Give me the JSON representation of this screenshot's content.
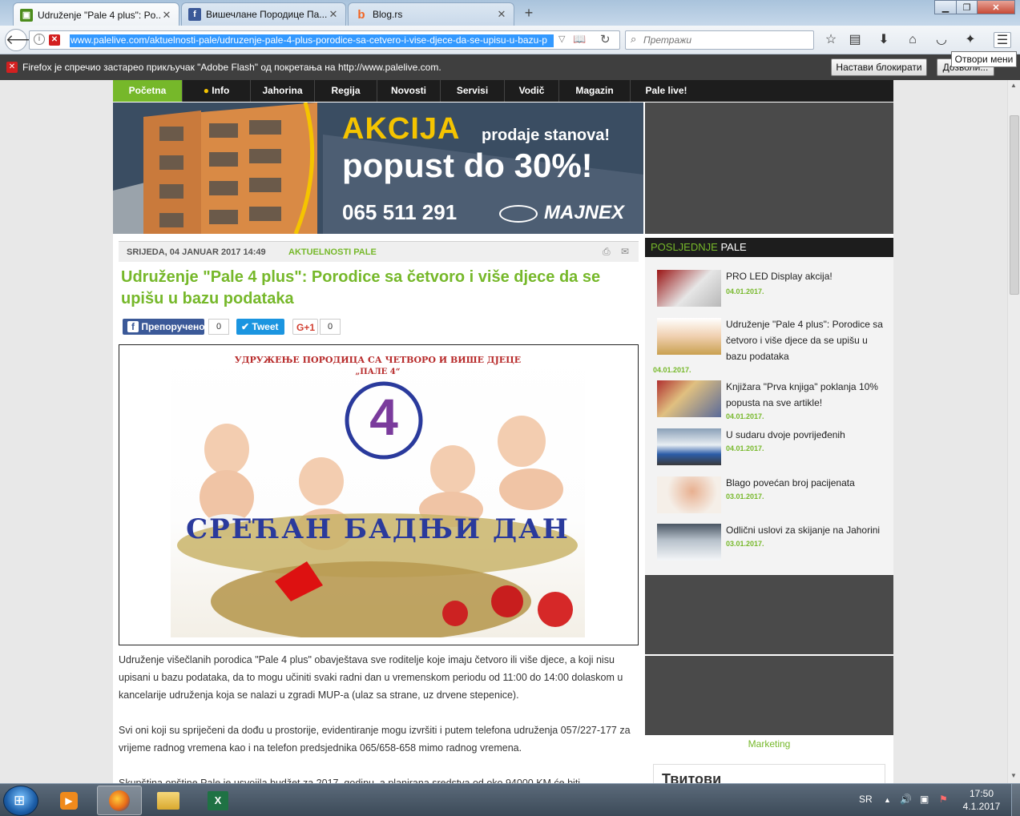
{
  "tabs": [
    {
      "label": "Udruženje \"Pale 4 plus\": Po...",
      "active": true,
      "favicon": "palelive-icon"
    },
    {
      "label": "Вишечлане Породице Па...",
      "active": false,
      "favicon": "facebook-icon"
    },
    {
      "label": "Blog.rs",
      "active": false,
      "favicon": "blog-icon"
    }
  ],
  "toolbar": {
    "url": "www.palelive.com/aktuelnosti-pale/udruzenje-pale-4-plus-porodice-sa-cetvero-i-vise-djece-da-se-upisu-u-bazu-p",
    "search_placeholder": "Претражи",
    "menu_tooltip": "Отвори мени"
  },
  "notification": {
    "message": "Firefox je спречио застарео прикључак \"Adobe Flash\" од покретања на http://www.palelive.com.",
    "continue_blocking": "Настави блокирати",
    "allow": "Дозволи..."
  },
  "menu": [
    "Početna",
    "Info",
    "Jahorina",
    "Regija",
    "Novosti",
    "Servisi",
    "Vodič",
    "Magazin",
    "Pale live!"
  ],
  "banner": {
    "headline": "AKCIJA",
    "sub": "prodaje stanova!",
    "discount": "popust do 30%!",
    "phone": "065 511 291",
    "brand": "MAJNEX"
  },
  "article": {
    "date": "SRIJEDA, 04 JANUAR 2017 14:49",
    "category": "AKTUELNOSTI PALE",
    "title": "Udruženje \"Pale 4 plus\": Porodice sa četvoro i više djece da se upišu u bazu podataka",
    "social": {
      "fb_label": "Препоручено",
      "fb_count": "0",
      "tw_label": "Tweet",
      "gp_label": "G+1",
      "gp_count": "0"
    },
    "image": {
      "top_text": "УДРУЖЕЊЕ ПОРОДИЦА СА ЧЕТВОРО И ВИШЕ ДЈЕЦЕ",
      "top_text2": "„ПАЛЕ 4“",
      "logo_digit": "4",
      "greeting": "СРЕЋАН БАДЊИ ДАН"
    },
    "paragraphs": [
      "Udruženje višečlanih porodica \"Pale 4 plus\" obavještava sve roditelje koje imaju četvoro ili više djece, a koji nisu upisani u bazu podataka, da to mogu učiniti svaki radni dan u vremenskom periodu od 11:00 do 14:00 dolaskom u kancelarije udruženja koja se nalazi u zgradi MUP-a (ulaz sa strane, uz drvene stepenice).",
      "Svi oni koji su spriječeni da dođu u prostorije, evidentiranje mogu izvršiti i putem telefona udruženja 057/227-177 za vrijeme radnog vremena kao i na telefon predsjednika 065/658-658 mimo radnog vremena.",
      "Skupština opštine Pale je usvojila budžet za 2017. godinu, a planirana sredstva od oko 94000 KM će biti"
    ]
  },
  "sidebar": {
    "head_a": "POSLJEDNJE",
    "head_b": "PALE",
    "items": [
      {
        "title": "PRO LED Display akcija!",
        "date": "04.01.2017."
      },
      {
        "title": "Udruženje \"Pale 4 plus\": Porodice sa četvoro i više djece da se upišu u bazu podataka",
        "date": "04.01.2017."
      },
      {
        "title": "Knjižara \"Prva knjiga\" poklanja 10% popusta na sve artikle!",
        "date": "04.01.2017."
      },
      {
        "title": "U sudaru dvoje povrijeđenih",
        "date": "04.01.2017."
      },
      {
        "title": "Blago povećan broj pacijenata",
        "date": "03.01.2017."
      },
      {
        "title": "Odlični uslovi za skijanje na Jahorini",
        "date": "03.01.2017."
      }
    ],
    "marketing": "Marketing",
    "tweets": "Твитови"
  },
  "taskbar": {
    "lang": "SR",
    "time": "17:50",
    "date": "4.1.2017"
  },
  "colors": {
    "accent": "#76b82a",
    "menu_bg": "#1d1d1d",
    "ad_gray": "#4a4a4a"
  }
}
